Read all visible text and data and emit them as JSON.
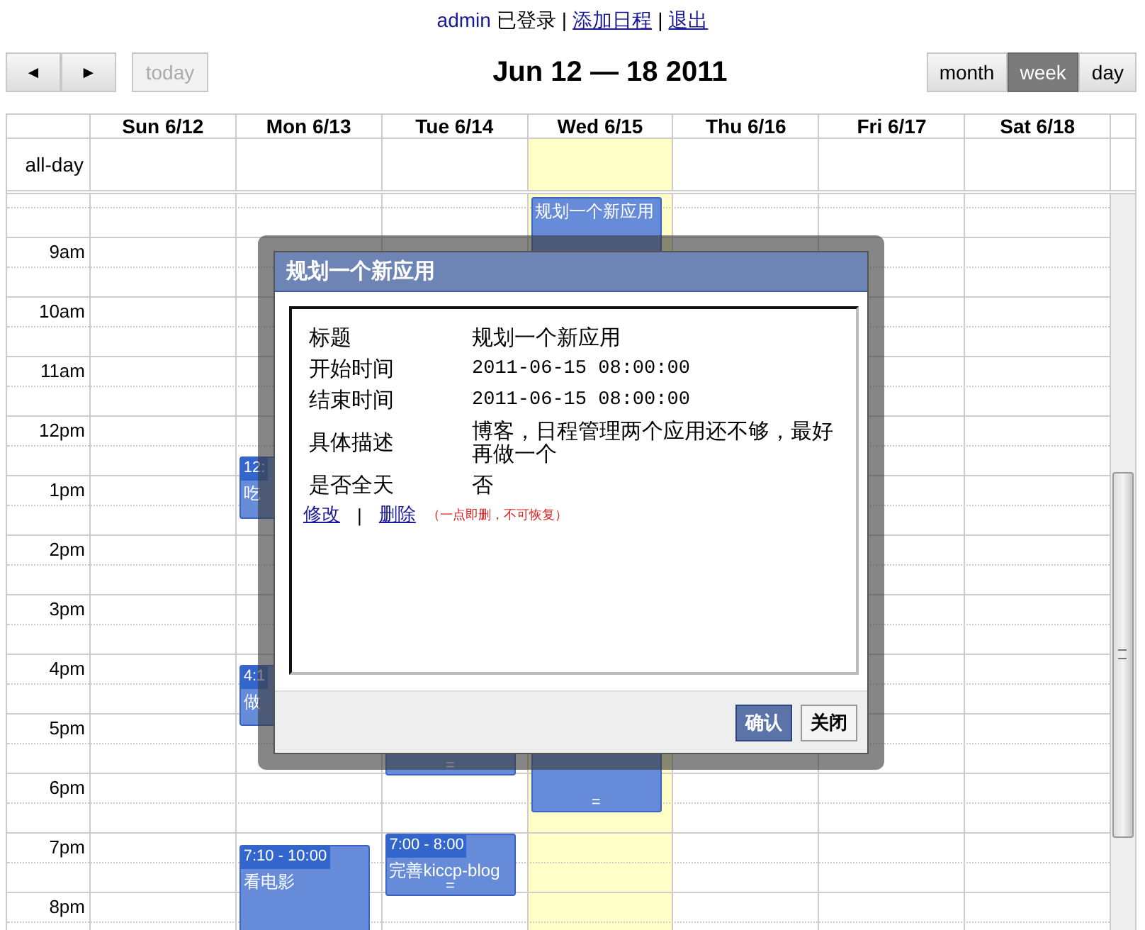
{
  "header": {
    "user": "admin",
    "status": "已登录",
    "separator": "|",
    "links": [
      {
        "label": "添加日程"
      },
      {
        "label": "退出"
      }
    ]
  },
  "toolbar": {
    "prev": "◄",
    "next": "►",
    "today": {
      "label": "today",
      "disabled": true
    },
    "title": "Jun 12 — 18 2011",
    "views": [
      {
        "label": "month",
        "selected": false
      },
      {
        "label": "week",
        "selected": true
      },
      {
        "label": "day",
        "selected": false
      }
    ]
  },
  "calendar": {
    "all_day_label": "all-day",
    "hours": [
      "9am",
      "10am",
      "11am",
      "12pm",
      "1pm",
      "2pm",
      "3pm",
      "4pm",
      "5pm",
      "6pm",
      "7pm",
      "8pm"
    ],
    "days": [
      {
        "label": "Sun 6/12",
        "today": false
      },
      {
        "label": "Mon 6/13",
        "today": false,
        "events": [
          {
            "time": "12:",
            "title": "吃"
          },
          {
            "time": "4:1",
            "title": "做"
          },
          {
            "time": "7:10 - 10:00",
            "title": "看电影"
          }
        ]
      },
      {
        "label": "Tue 6/14",
        "today": false,
        "events": [
          {
            "handle": "="
          },
          {
            "time": "7:00 - 8:00",
            "title": "完善kiccp-blog",
            "handle": "="
          }
        ]
      },
      {
        "label": "Wed 6/15",
        "today": true,
        "events": [
          {
            "title": "规划一个新应用",
            "handle": "="
          }
        ]
      },
      {
        "label": "Thu 6/16",
        "today": false
      },
      {
        "label": "Fri 6/17",
        "today": false
      },
      {
        "label": "Sat 6/18",
        "today": false
      }
    ]
  },
  "dialog": {
    "title": "规划一个新应用",
    "fields": [
      {
        "label": "标题",
        "value": "规划一个新应用"
      },
      {
        "label": "开始时间",
        "value": "2011-06-15 08:00:00",
        "kind": "mono"
      },
      {
        "label": "结束时间",
        "value": "2011-06-15 08:00:00",
        "kind": "mono"
      },
      {
        "label": "具体描述",
        "value": "博客，日程管理两个应用还不够，最好再做一个"
      },
      {
        "label": "是否全天",
        "value": "否"
      }
    ],
    "edit_link": "修改",
    "separator": "|",
    "delete_link": "删除",
    "delete_note": "（一点即删，不可恢复）",
    "buttons": [
      {
        "label": "确认",
        "primary": true
      },
      {
        "label": "关闭",
        "primary": false
      }
    ]
  }
}
